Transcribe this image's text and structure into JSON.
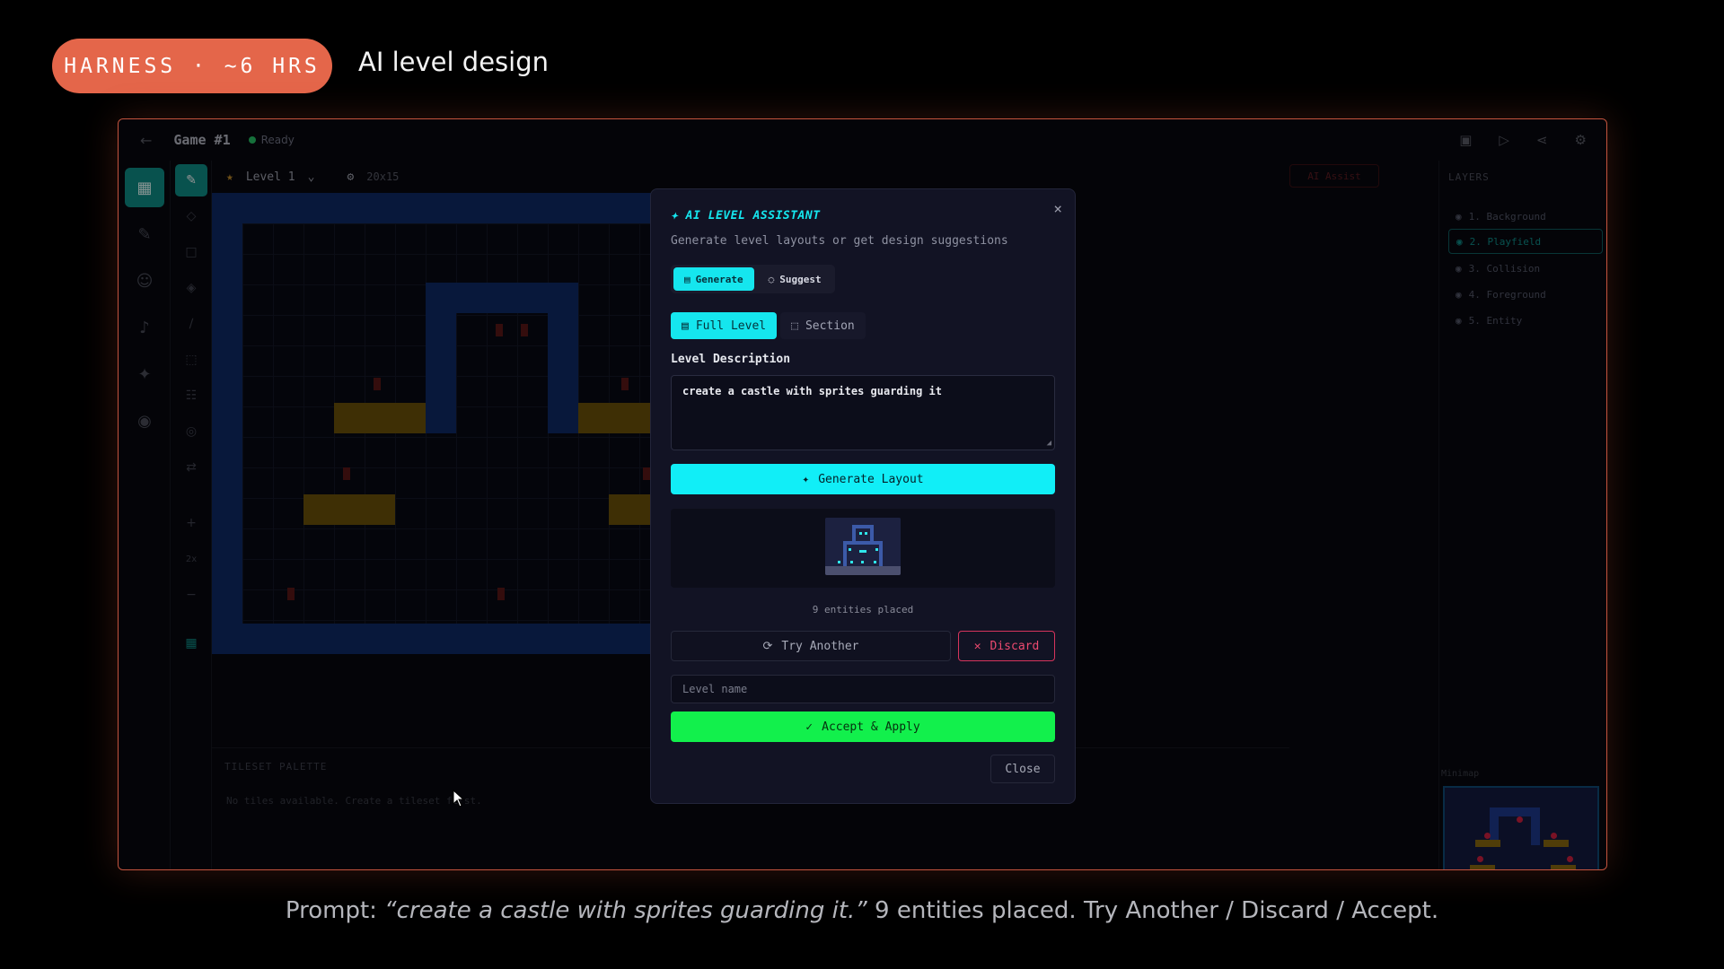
{
  "slide": {
    "badge": "HARNESS · ~6 HRS",
    "title": "AI level design",
    "caption_prefix": "Prompt: ",
    "caption_quote": "“create a castle with sprites guarding it.”",
    "caption_suffix": " 9 entities placed. Try Another / Discard / Accept."
  },
  "app": {
    "back_icon": "←",
    "game_title": "Game #1",
    "status": "Ready",
    "level": "Level 1",
    "grid_size": "20x15",
    "ai_assist": "AI Assist",
    "palette_title": "TILESET PALETTE",
    "palette_empty": "No tiles available. Create a tileset first.",
    "zoom": "2x",
    "layers_title": "LAYERS",
    "layers": [
      "1. Background",
      "2. Playfield",
      "3. Collision",
      "4. Foreground",
      "5. Entity"
    ],
    "selected_layer": 1,
    "minimap_label": "Minimap"
  },
  "modal": {
    "title": "AI LEVEL ASSISTANT",
    "subtitle": "Generate level layouts or get design suggestions",
    "mode_tabs": [
      "Generate",
      "Suggest"
    ],
    "active_mode": "Generate",
    "scope_tabs": [
      "Full Level",
      "Section"
    ],
    "active_scope": "Full Level",
    "description_label": "Level Description",
    "description_value": "create a castle with sprites guarding it",
    "generate_label": "Generate Layout",
    "entities_text": "9 entities placed",
    "try_another_label": "Try Another",
    "discard_label": "Discard",
    "level_name_placeholder": "Level name",
    "accept_label": "Accept & Apply",
    "close_label": "Close",
    "close_icon": "×"
  },
  "colors": {
    "badge": "#e4664a",
    "frame_border": "#c4543e",
    "accent_cyan": "#11eef7",
    "accent_green": "#12f04c",
    "danger": "#ee4a70",
    "teal": "#0e8d87"
  }
}
